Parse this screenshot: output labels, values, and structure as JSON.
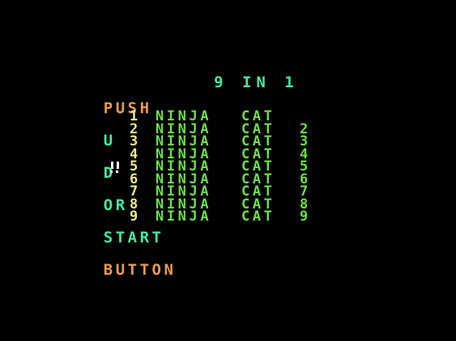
{
  "colors": {
    "background": "#000000",
    "title": "#46e6a0",
    "accent": "#e79a4f",
    "menu_number": "#f0e68c",
    "menu_text": "#6cde4a",
    "cursor": "#ffffff"
  },
  "header": {
    "title": "9 IN 1"
  },
  "instructions": {
    "push": "PUSH",
    "u": "U",
    "d": "D",
    "or": "OR",
    "start": "START",
    "button": "BUTTON"
  },
  "menu": {
    "selected_index": 4,
    "cursor_icon": "double-exclamation-cursor-icon",
    "items": [
      {
        "number": "1",
        "name": "NINJA",
        "cat": "CAT",
        "suffix": ""
      },
      {
        "number": "2",
        "name": "NINJA",
        "cat": "CAT",
        "suffix": "2"
      },
      {
        "number": "3",
        "name": "NINJA",
        "cat": "CAT",
        "suffix": "3"
      },
      {
        "number": "4",
        "name": "NINJA",
        "cat": "CAT",
        "suffix": "4"
      },
      {
        "number": "5",
        "name": "NINJA",
        "cat": "CAT",
        "suffix": "5"
      },
      {
        "number": "6",
        "name": "NINJA",
        "cat": "CAT",
        "suffix": "6"
      },
      {
        "number": "7",
        "name": "NINJA",
        "cat": "CAT",
        "suffix": "7"
      },
      {
        "number": "8",
        "name": "NINJA",
        "cat": "CAT",
        "suffix": "8"
      },
      {
        "number": "9",
        "name": "NINJA",
        "cat": "CAT",
        "suffix": "9"
      }
    ]
  }
}
